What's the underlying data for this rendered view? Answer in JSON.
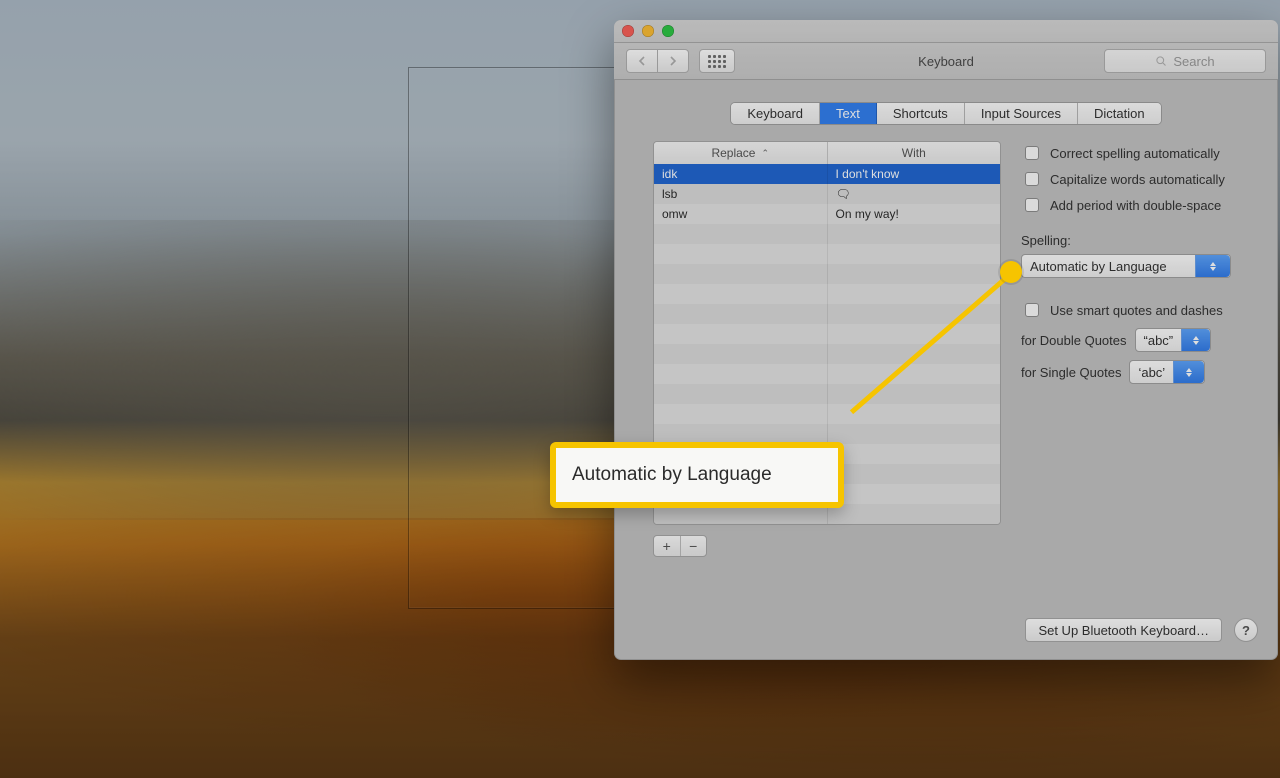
{
  "toolbar": {
    "title": "Keyboard",
    "search_placeholder": "Search"
  },
  "tabs": [
    "Keyboard",
    "Text",
    "Shortcuts",
    "Input Sources",
    "Dictation"
  ],
  "active_tab": "Text",
  "table": {
    "headers": {
      "replace": "Replace",
      "with": "With"
    },
    "rows": [
      {
        "replace": "idk",
        "with": "I don't know"
      },
      {
        "replace": "lsb",
        "with": "🗨"
      },
      {
        "replace": "omw",
        "with": "On my way!"
      }
    ]
  },
  "checks": {
    "correct_spelling": "Correct spelling automatically",
    "capitalize": "Capitalize words automatically",
    "double_space_period": "Add period with double-space",
    "smart_quotes": "Use smart quotes and dashes"
  },
  "spelling": {
    "label": "Spelling:",
    "value": "Automatic by Language"
  },
  "quotes": {
    "double_label": "for Double Quotes",
    "double_value": "“abc”",
    "single_label": "for Single Quotes",
    "single_value": "‘abc’"
  },
  "footer": {
    "bluetooth": "Set Up Bluetooth Keyboard…"
  },
  "callout": {
    "text": "Automatic by Language"
  }
}
